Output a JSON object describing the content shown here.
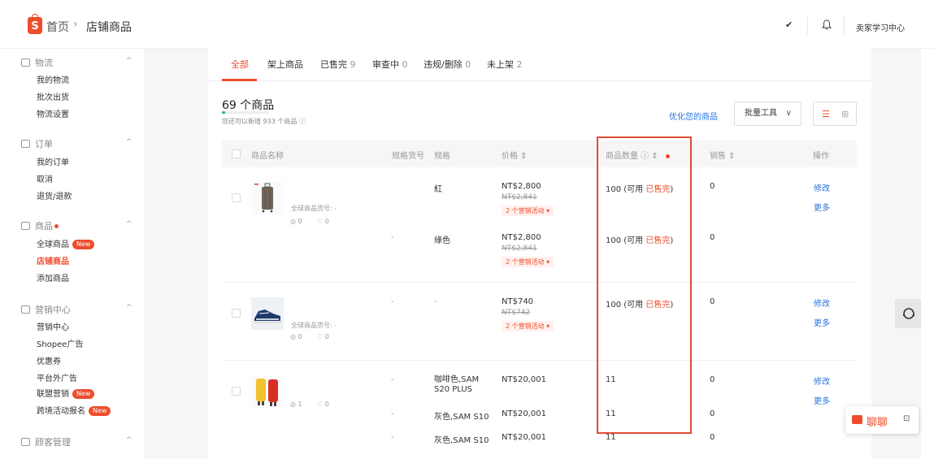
{
  "header": {
    "logo_letter": "S",
    "breadcrumb_home": "首页",
    "breadcrumb_sep": "›",
    "breadcrumb_current": "店铺商品",
    "account_chevron": "✔",
    "learn_center": "卖家学习中心"
  },
  "sidebar": {
    "sections": [
      {
        "title": "物流",
        "icon": "truck-icon",
        "items": [
          "我的物流",
          "批次出货",
          "物流设置"
        ]
      },
      {
        "title": "订单",
        "icon": "clipboard-icon",
        "items": [
          "我的订单",
          "取消",
          "退货/退款"
        ]
      },
      {
        "title": "商品",
        "icon": "box-icon",
        "items": [
          "全球商品",
          "店铺商品",
          "添加商品"
        ]
      },
      {
        "title": "营销中心",
        "icon": "tag-icon",
        "items": [
          "营销中心",
          "Shopee广告",
          "优惠券",
          "平台外广告",
          "联盟营销",
          "跨境活动报名"
        ]
      },
      {
        "title": "顾客管理",
        "icon": "person-icon",
        "items": []
      }
    ],
    "new_badge": "New",
    "caret": "^"
  },
  "tabs": [
    {
      "label": "全部",
      "count": ""
    },
    {
      "label": "架上商品",
      "count": ""
    },
    {
      "label": "已售完",
      "count": "9"
    },
    {
      "label": "审查中",
      "count": "0"
    },
    {
      "label": "违规/删除",
      "count": "0"
    },
    {
      "label": "未上架",
      "count": "2"
    }
  ],
  "summary": {
    "count_title": "69 个商品",
    "count_note": "您还可以新增 933 个商品 ⓘ",
    "progress_fraction": 0.069,
    "optimize_link": "优化您的商品",
    "bulk_tools": "批量工具",
    "bulk_chevron": "∨",
    "view_list_icon": "☰",
    "view_grid_icon": "⊞"
  },
  "table": {
    "headers": {
      "name": "商品名称",
      "sku": "规格货号",
      "variation": "规格",
      "price": "价格 ⇕",
      "stock": "商品数量 ⓘ ⇕",
      "sales": "销售 ⇕",
      "actions": "操作"
    },
    "products": [
      {
        "name_meta": "全球商品货号: -",
        "views": "0",
        "likes": "0",
        "variants": [
          {
            "sku": "",
            "variation": "紅",
            "price": "NT$2,800",
            "price_old": "NT$2,841",
            "promo": "2 个营销活动 ▾",
            "stock": "100 (可用 ",
            "stock_sold": "已售完",
            "stock_end": ")",
            "sales": "0"
          },
          {
            "sku": "-",
            "variation": "綠色",
            "price": "NT$2,800",
            "price_old": "NT$2,841",
            "promo": "2 个营销活动 ▾",
            "stock": "100 (可用 ",
            "stock_sold": "已售完",
            "stock_end": ")",
            "sales": "0"
          }
        ],
        "actions": [
          "修改",
          "更多"
        ]
      },
      {
        "name_meta": "全球商品货号: -",
        "views": "0",
        "likes": "0",
        "variants": [
          {
            "sku": "-",
            "variation": "-",
            "price": "NT$740",
            "price_old": "NT$742",
            "promo": "2 个营销活动 ▾",
            "stock": "100 (可用 ",
            "stock_sold": "已售完",
            "stock_end": ")",
            "sales": "0"
          }
        ],
        "actions": [
          "修改",
          "更多"
        ]
      },
      {
        "name_meta": "",
        "views": "1",
        "likes": "0",
        "variants": [
          {
            "sku": "-",
            "variation": "咖啡色,SAM S20 PLUS",
            "price": "NT$20,001",
            "stock": "11",
            "sales": "0"
          },
          {
            "sku": "-",
            "variation": "灰色,SAM S10",
            "price": "NT$20,001",
            "stock": "11",
            "sales": "0"
          },
          {
            "sku": "-",
            "variation": "灰色,SAM S10",
            "price": "NT$20,001",
            "stock": "11",
            "sales": "0"
          }
        ],
        "actions": [
          "修改",
          "更多"
        ]
      }
    ]
  },
  "chat": {
    "label": "聊聊",
    "min_icon": "⊡"
  },
  "colors": {
    "brand": "#ee4d2d",
    "link": "#2673dd",
    "highlight": "#e24b33"
  }
}
